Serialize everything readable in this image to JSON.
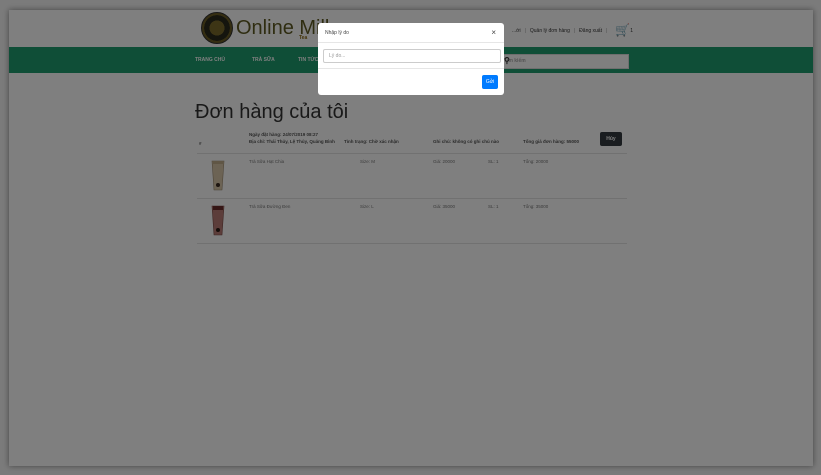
{
  "header": {
    "logo_text": "Online Milk",
    "logo_sub": "Tea",
    "links": [
      "...ới",
      "Quản lý đơn hàng",
      "Đăng xuất"
    ],
    "cart_count": "1"
  },
  "nav": {
    "items": [
      "TRANG CHỦ",
      "TRÀ SỮA",
      "TIN TỨC"
    ],
    "search_placeholder": "Tìm kiếm"
  },
  "page": {
    "title": "Đơn hàng của tôi",
    "table": {
      "hash": "#",
      "order_date": "Ngày đặt hàng: 24/07/2019 08:27",
      "address": "Địa chỉ: Thái Thủy, Lệ Thủy, Quảng Bình",
      "status": "Tình trạng: Chờ xác nhận",
      "note": "Ghi chú: không có ghi chú nào",
      "total": "Tổng giá đơn hàng: 55000",
      "cancel_label": "Hủy"
    },
    "items": [
      {
        "name": "Trà Sữa Hạt Chia",
        "size": "Size: M",
        "price": "Giá: 20000",
        "qty": "SL: 1",
        "total": "Tổng: 20000"
      },
      {
        "name": "Trà Sữa Đường Đen",
        "size": "Size: L",
        "price": "Giá: 35000",
        "qty": "SL: 1",
        "total": "Tổng: 35000"
      }
    ]
  },
  "modal": {
    "title": "Nhập lý do",
    "close": "×",
    "input_placeholder": "Lý do...",
    "submit_label": "Gửi"
  }
}
